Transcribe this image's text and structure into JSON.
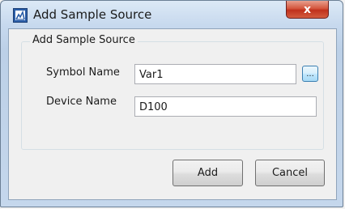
{
  "window": {
    "title": "Add Sample Source",
    "close_glyph": "x"
  },
  "group": {
    "legend": "Add Sample Source"
  },
  "fields": {
    "symbol_label": "Symbol Name",
    "symbol_value": "Var1",
    "browse_label": "...",
    "device_label": "Device Name",
    "device_value": "D100"
  },
  "buttons": {
    "add": "Add",
    "cancel": "Cancel"
  },
  "icons": {
    "app": "window-app-icon",
    "close": "close-icon"
  }
}
